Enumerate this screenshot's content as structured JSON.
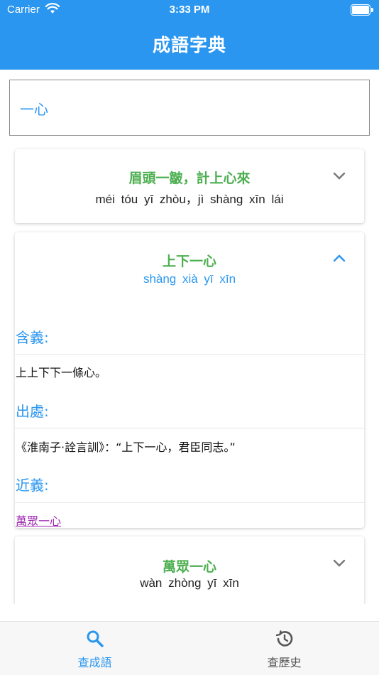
{
  "status_bar": {
    "carrier": "Carrier",
    "time": "3:33 PM"
  },
  "app": {
    "title": "成語字典",
    "accent_color": "#2a96f0"
  },
  "search": {
    "value": "一心"
  },
  "results": [
    {
      "idiom": "眉頭一皺，計上心來",
      "pinyin": "méi  tóu  yī  zhòu，jì  shàng  xīn  lái",
      "expanded": false,
      "chevron": "chevron-down-icon"
    },
    {
      "idiom": "上下一心",
      "pinyin": "shàng  xià  yī  xīn",
      "expanded": true,
      "chevron": "chevron-up-icon",
      "sections": {
        "meaning_label": "含義:",
        "meaning": "上上下下一條心。",
        "source_label": "出處:",
        "source": "《淮南子·詮言訓》：“上下一心，君臣同志。”",
        "synonym_label": "近義:",
        "synonym": "萬眾一心"
      }
    },
    {
      "idiom": "萬眾一心",
      "pinyin": "wàn  zhòng  yī  xīn",
      "expanded": false,
      "chevron": "chevron-down-icon"
    }
  ],
  "bottom_nav": {
    "tabs": [
      {
        "label": "查成語",
        "icon": "search-icon",
        "active": true
      },
      {
        "label": "查歷史",
        "icon": "history-icon",
        "active": false
      }
    ]
  }
}
